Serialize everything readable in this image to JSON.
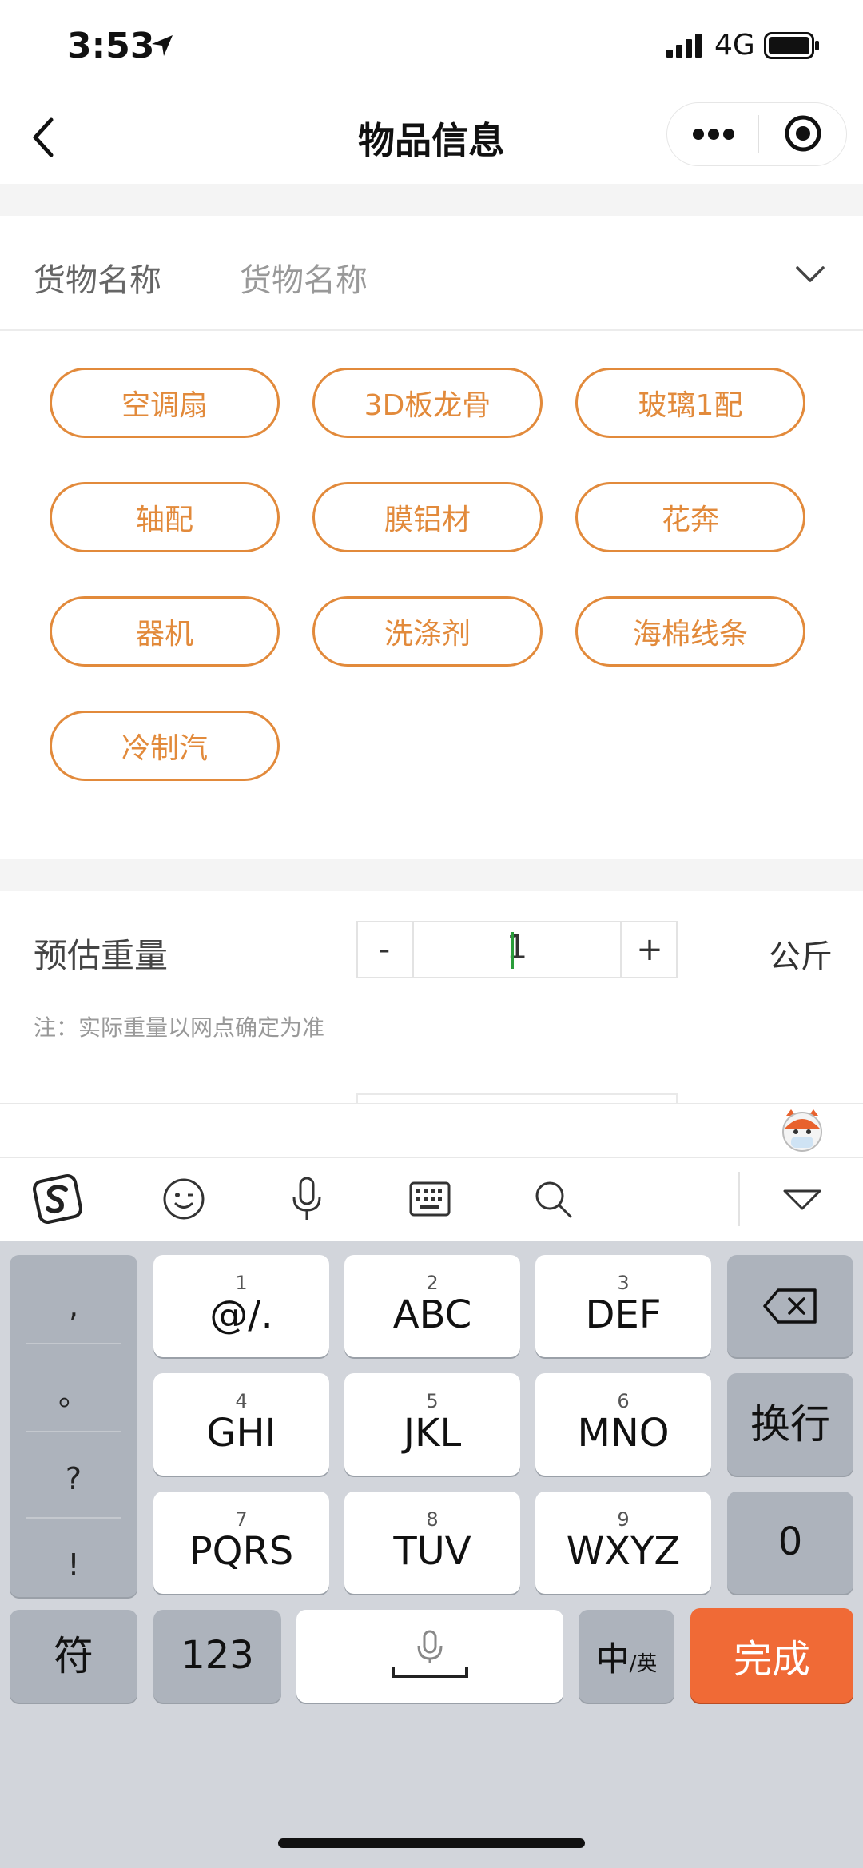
{
  "status_bar": {
    "time": "3:53",
    "network": "4G"
  },
  "nav": {
    "title": "物品信息"
  },
  "cargo": {
    "label": "货物名称",
    "placeholder": "货物名称",
    "tags": [
      "空调扇",
      "3D板龙骨",
      "玻璃1配",
      "轴配",
      "膜铝材",
      "花奔",
      "器机",
      "洗涤剂",
      "海棉线条",
      "冷制汽"
    ]
  },
  "weight": {
    "label": "预估重量",
    "minus": "-",
    "value": "1",
    "plus": "+",
    "unit": "公斤",
    "note": "注：实际重量以网点确定为准"
  },
  "keyboard": {
    "side_keys": [
      ",",
      "。",
      "?",
      "!"
    ],
    "keys": [
      {
        "num": "1",
        "main": "@/."
      },
      {
        "num": "2",
        "main": "ABC"
      },
      {
        "num": "3",
        "main": "DEF"
      },
      {
        "num": "4",
        "main": "GHI"
      },
      {
        "num": "5",
        "main": "JKL"
      },
      {
        "num": "6",
        "main": "MNO"
      },
      {
        "num": "7",
        "main": "PQRS"
      },
      {
        "num": "8",
        "main": "TUV"
      },
      {
        "num": "9",
        "main": "WXYZ"
      }
    ],
    "newline": "换行",
    "zero": "0",
    "symbol": "符",
    "numeric": "123",
    "lang_main": "中",
    "lang_sub": "/英",
    "done": "完成",
    "accent_color": "#f06a36"
  }
}
